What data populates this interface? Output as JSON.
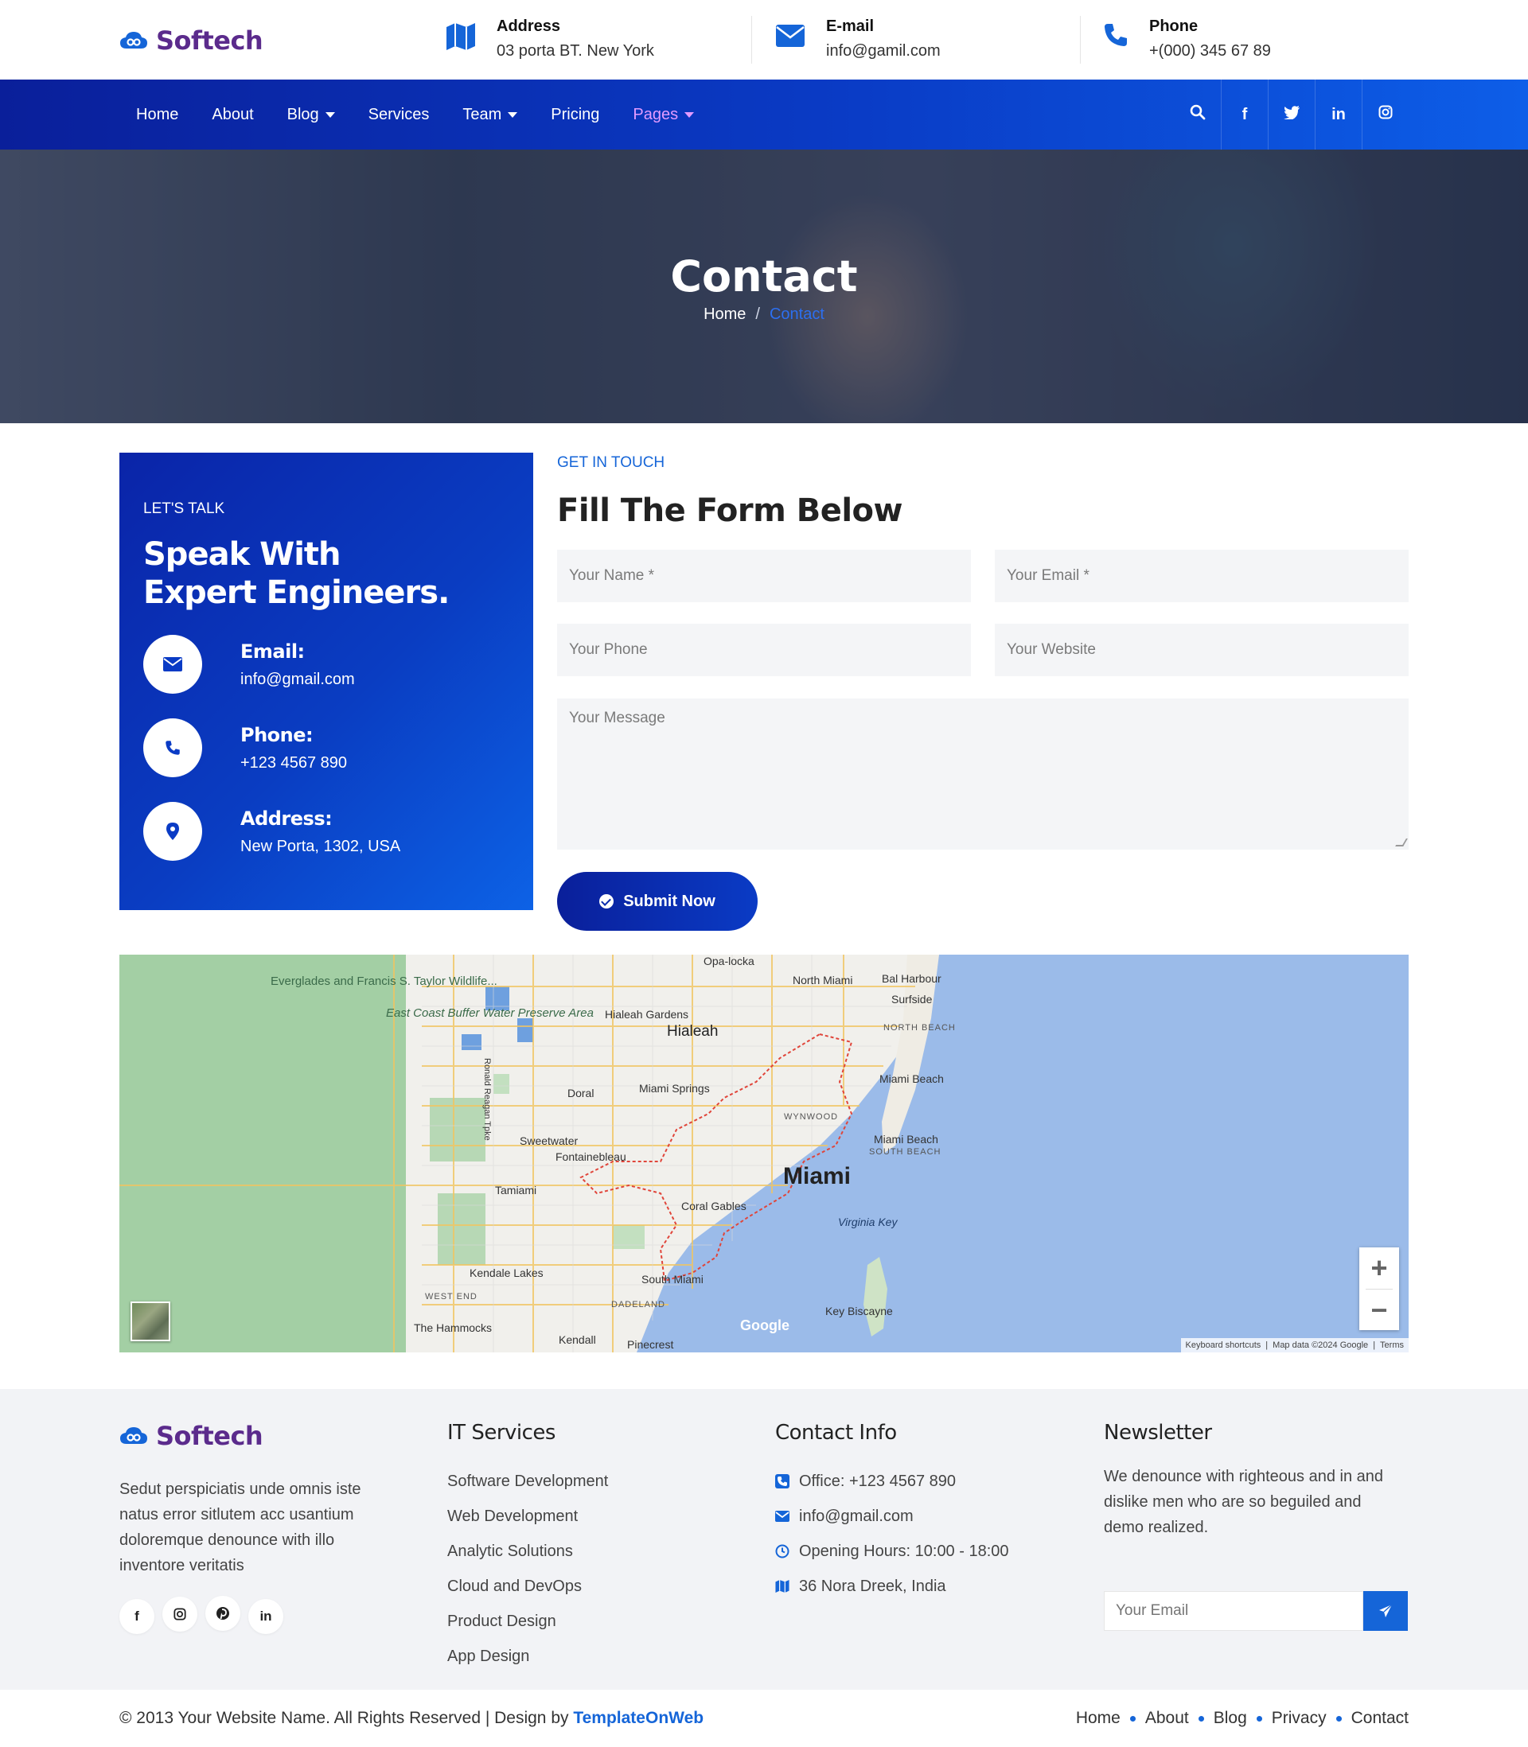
{
  "brand": {
    "name": "Softech"
  },
  "topbar": {
    "address": {
      "title": "Address",
      "value": "03 porta BT. New York",
      "icon": "map-icon"
    },
    "email": {
      "title": "E-mail",
      "value": "info@gamil.com",
      "icon": "envelope-icon"
    },
    "phone": {
      "title": "Phone",
      "value": "+(000) 345 67 89",
      "icon": "phone-icon"
    }
  },
  "nav": {
    "items": [
      {
        "label": "Home"
      },
      {
        "label": "About"
      },
      {
        "label": "Blog",
        "dropdown": true
      },
      {
        "label": "Services"
      },
      {
        "label": "Team",
        "dropdown": true
      },
      {
        "label": "Pricing"
      },
      {
        "label": "Pages",
        "dropdown": true,
        "active": true
      }
    ],
    "social": [
      "search-icon",
      "facebook-icon",
      "twitter-icon",
      "linkedin-icon",
      "instagram-icon"
    ]
  },
  "hero": {
    "title": "Contact",
    "breadcrumb": {
      "home": "Home",
      "separator": "/",
      "current": "Contact"
    }
  },
  "talk": {
    "eyebrow": "LET'S TALK",
    "heading": "Speak With Expert Engineers.",
    "email": {
      "label": "Email:",
      "value": "info@gmail.com"
    },
    "phone": {
      "label": "Phone:",
      "value": "+123 4567 890"
    },
    "address": {
      "label": "Address:",
      "value": "New Porta, 1302, USA"
    }
  },
  "form": {
    "eyebrow": "GET IN TOUCH",
    "heading": "Fill The Form Below",
    "name_placeholder": "Your Name *",
    "email_placeholder": "Your Email *",
    "phone_placeholder": "Your Phone",
    "website_placeholder": "Your Website",
    "message_placeholder": "Your Message",
    "submit_label": "Submit Now"
  },
  "map": {
    "labels": {
      "miami": "Miami",
      "hialeah": "Hialeah",
      "hialeah_gardens": "Hialeah Gardens",
      "opa_locka": "Opa-locka",
      "north_miami": "North Miami",
      "bal_harbour": "Bal Harbour",
      "surfside": "Surfside",
      "north_beach": "NORTH BEACH",
      "miami_beach": "Miami Beach",
      "miami_beach2": "Miami Beach",
      "south_beach": "SOUTH BEACH",
      "doral": "Doral",
      "miami_springs": "Miami Springs",
      "wynwood": "WYNWOOD",
      "sweetwater": "Sweetwater",
      "fontainebleau": "Fontainebleau",
      "tamiami": "Tamiami",
      "coral_gables": "Coral Gables",
      "virginia_key": "Virginia Key",
      "kendale_lakes": "Kendale Lakes",
      "south_miami": "South Miami",
      "west_end": "WEST END",
      "dadeland": "DADELAND",
      "the_hammocks": "The Hammocks",
      "kendall": "Kendall",
      "pinecrest": "Pinecrest",
      "key_biscayne": "Key Biscayne",
      "everglades": "Everglades and Francis S. Taylor Wildlife...",
      "east_coast": "East Coast Buffer Water Preserve Area",
      "ronald_reagan": "Ronald Reagan Tpke",
      "google": "Google"
    },
    "attribution": {
      "shortcuts": "Keyboard shortcuts",
      "data": "Map data ©2024 Google",
      "terms": "Terms"
    },
    "zoom_in": "+",
    "zoom_out": "−"
  },
  "footer": {
    "about_text": "Sedut perspiciatis unde omnis iste natus error sitlutem acc usantium doloremque denounce with illo inventore veritatis",
    "social": [
      "facebook-icon",
      "instagram-icon",
      "pinterest-icon",
      "linkedin-icon"
    ],
    "services": {
      "heading": "IT Services",
      "items": [
        "Software Development",
        "Web Development",
        "Analytic Solutions",
        "Cloud and DevOps",
        "Product Design",
        "App Design"
      ]
    },
    "contact": {
      "heading": "Contact Info",
      "office": "Office: +123 4567 890",
      "email": "info@gmail.com",
      "hours": "Opening Hours: 10:00 - 18:00",
      "address": "36 Nora Dreek, India"
    },
    "newsletter": {
      "heading": "Newsletter",
      "text": "We denounce with righteous and in and dislike men who are so beguiled and demo realized.",
      "placeholder": "Your Email"
    }
  },
  "bottom": {
    "copyright": "© 2013 Your Website Name. All Rights Reserved | Design by",
    "brand": "TemplateOnWeb",
    "links": [
      "Home",
      "About",
      "Blog",
      "Privacy",
      "Contact"
    ]
  },
  "colors": {
    "primary": "#0a3bc5",
    "accent": "#1565d8",
    "brand": "#5b2b8c",
    "active_nav": "#e39bff"
  }
}
